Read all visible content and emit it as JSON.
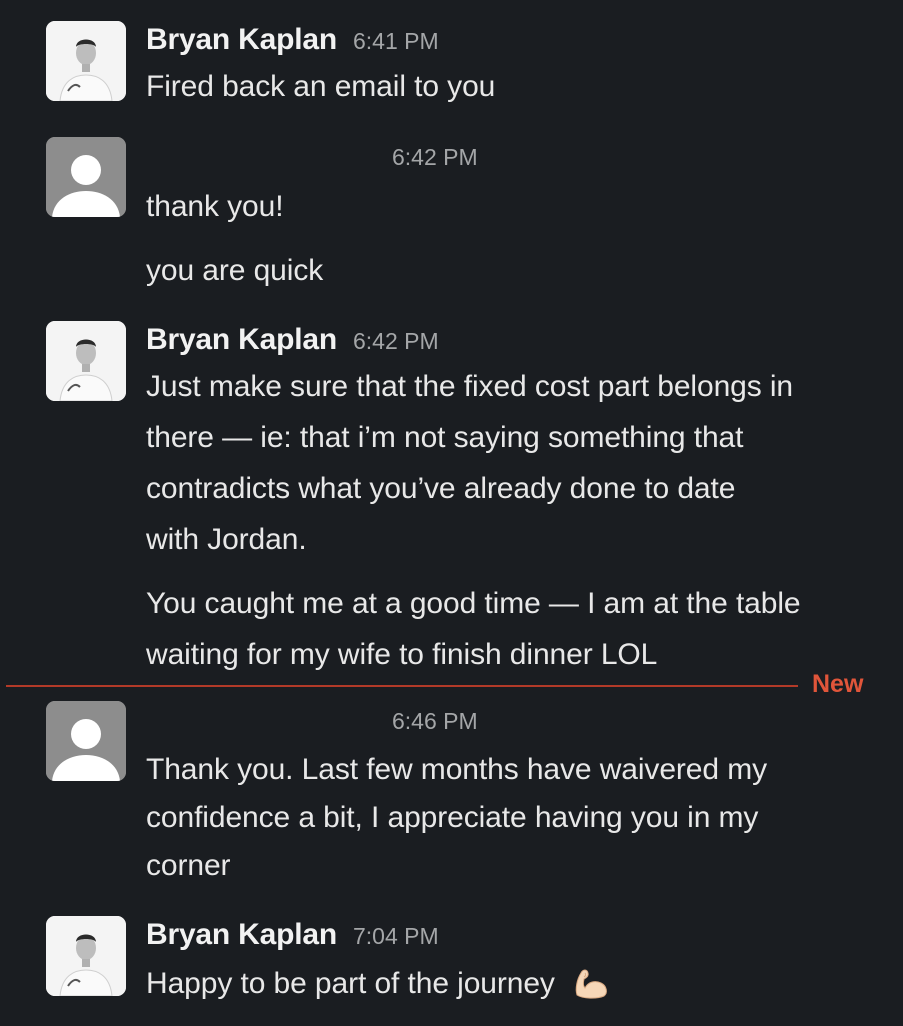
{
  "messages": [
    {
      "author": "Bryan Kaplan",
      "time": "6:41 PM",
      "avatar": "person-photo",
      "lines": [
        "Fired back an email to you"
      ]
    },
    {
      "author": "",
      "time": "6:42 PM",
      "avatar": "default-user",
      "lines": [
        "thank you!"
      ],
      "followups": [
        "you are quick"
      ]
    },
    {
      "author": "Bryan Kaplan",
      "time": "6:42 PM",
      "avatar": "person-photo",
      "lines": [
        "Just make sure that the fixed cost part belongs in",
        "there — ie: that i’m not saying something that",
        "contradicts what you’ve already done to date",
        "with Jordan."
      ],
      "followups": [
        "You caught me at a good time — I am at the table",
        "waiting for my wife to finish dinner LOL"
      ]
    },
    {
      "author": "",
      "time": "6:46 PM",
      "avatar": "default-user",
      "lines": [
        "Thank you. Last few months have waivered my",
        "confidence a bit, I appreciate having you in my",
        "corner"
      ]
    },
    {
      "author": "Bryan Kaplan",
      "time": "7:04 PM",
      "avatar": "person-photo",
      "lines": [
        "Happy to be part of the journey"
      ],
      "emoji": "flexed-biceps-icon"
    }
  ],
  "divider": {
    "label": "New",
    "color": "#e0553a"
  },
  "colors": {
    "background": "#1a1d21",
    "text": "#e8e8e8",
    "timestamp": "#a4a6a8"
  }
}
